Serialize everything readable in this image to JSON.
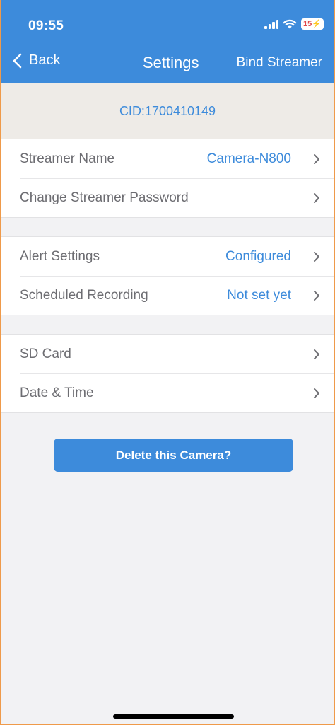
{
  "status_bar": {
    "time": "09:55",
    "battery": "15"
  },
  "navbar": {
    "back_label": "Back",
    "title": "Settings",
    "right_action": "Bind Streamer"
  },
  "cid": "CID:1700410149",
  "groups": {
    "streamer": {
      "name_label": "Streamer Name",
      "name_value": "Camera-N800",
      "password_label": "Change Streamer Password"
    },
    "alerts": {
      "alert_label": "Alert Settings",
      "alert_value": "Configured",
      "schedule_label": "Scheduled Recording",
      "schedule_value": "Not set yet"
    },
    "device": {
      "sd_label": "SD Card",
      "date_label": "Date & Time"
    }
  },
  "delete_button": "Delete this Camera?",
  "colors": {
    "accent": "#3d8bdb",
    "cid_band": "#eeebe7",
    "background": "#f2f2f4",
    "label": "#6d6d72"
  }
}
